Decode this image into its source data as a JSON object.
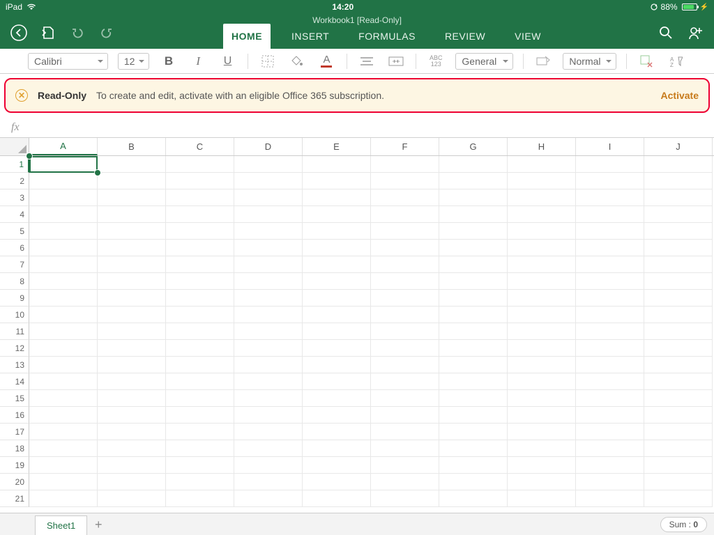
{
  "statusbar": {
    "device": "iPad",
    "time": "14:20",
    "battery_pct": "88%"
  },
  "document": {
    "title": "Workbook1 [Read-Only]"
  },
  "tabs": {
    "home": "HOME",
    "insert": "INSERT",
    "formulas": "FORMULAS",
    "review": "REVIEW",
    "view": "VIEW"
  },
  "ribbon": {
    "font_name": "Calibri",
    "font_size": "12",
    "number_format": "General",
    "cell_style": "Normal"
  },
  "notification": {
    "title": "Read-Only",
    "body": "To create and edit, activate with an eligible Office 365 subscription.",
    "action": "Activate"
  },
  "formula_bar": {
    "label": "fx"
  },
  "grid": {
    "columns": [
      "A",
      "B",
      "C",
      "D",
      "E",
      "F",
      "G",
      "H",
      "I",
      "J"
    ],
    "rows": [
      "1",
      "2",
      "3",
      "4",
      "5",
      "6",
      "7",
      "8",
      "9",
      "10",
      "11",
      "12",
      "13",
      "14",
      "15",
      "16",
      "17",
      "18",
      "19",
      "20",
      "21"
    ],
    "active_cell": "A1"
  },
  "sheets": {
    "active": "Sheet1"
  },
  "status": {
    "sum_label": "Sum : ",
    "sum_value": "0"
  }
}
